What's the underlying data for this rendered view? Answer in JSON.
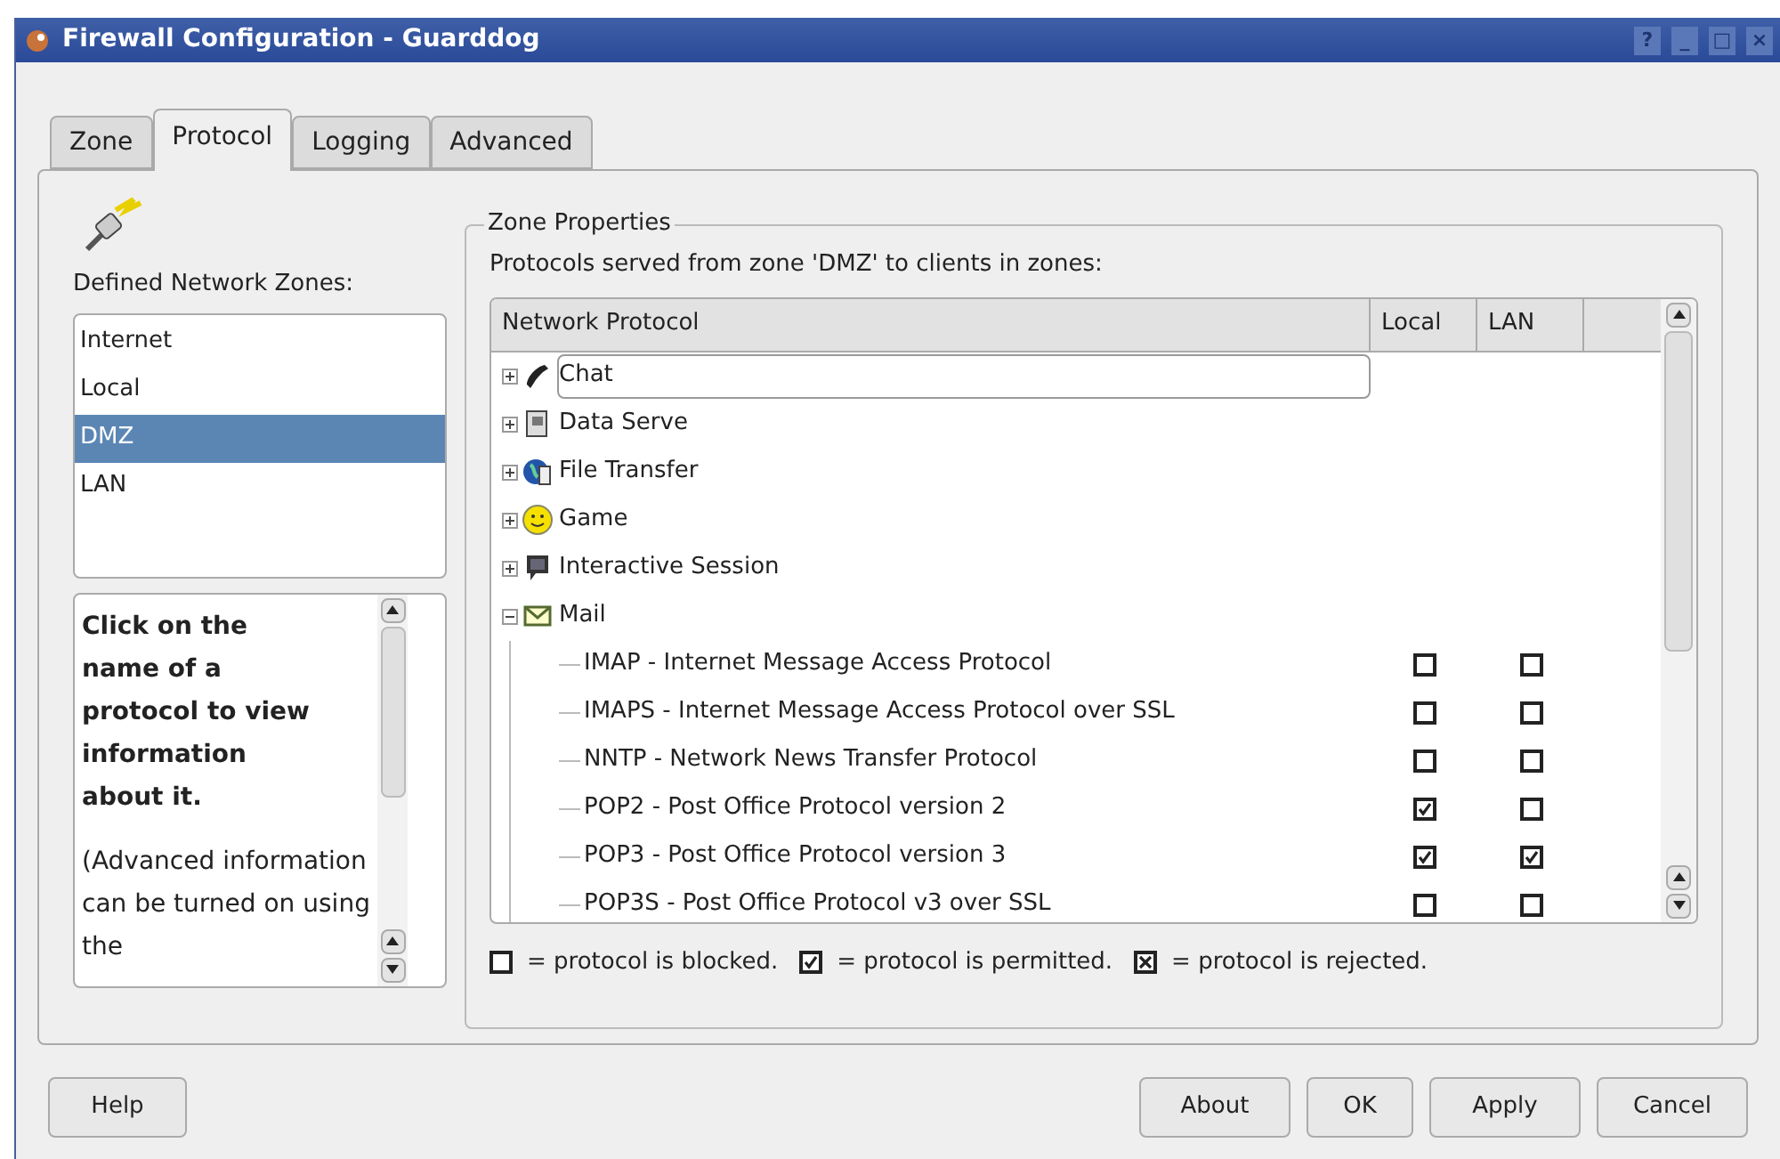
{
  "window": {
    "title": "Firewall Configuration - Guarddog",
    "title_buttons": [
      "?",
      "_",
      "□",
      "×"
    ]
  },
  "tabs": [
    {
      "label": "Zone",
      "selected": false
    },
    {
      "label": "Protocol",
      "selected": true
    },
    {
      "label": "Logging",
      "selected": false
    },
    {
      "label": "Advanced",
      "selected": false
    }
  ],
  "zones_label": "Defined Network Zones:",
  "zones": [
    {
      "label": "Internet",
      "selected": false
    },
    {
      "label": "Local",
      "selected": false
    },
    {
      "label": "DMZ",
      "selected": true
    },
    {
      "label": "LAN",
      "selected": false
    }
  ],
  "info": {
    "heading": "Click on the name of a protocol to view information about it.",
    "text": "(Advanced information can be turned on using the"
  },
  "zone_properties": {
    "title": "Zone Properties",
    "description": "Protocols served from zone 'DMZ' to clients in zones:",
    "columns": [
      "Network Protocol",
      "Local",
      "LAN"
    ],
    "tree": [
      {
        "label": "Chat",
        "expanded": false,
        "focused": true
      },
      {
        "label": "Data Serve",
        "expanded": false,
        "focused": false
      },
      {
        "label": "File Transfer",
        "expanded": false,
        "focused": false
      },
      {
        "label": "Game",
        "expanded": false,
        "focused": false
      },
      {
        "label": "Interactive Session",
        "expanded": false,
        "focused": false
      },
      {
        "label": "Mail",
        "expanded": true,
        "focused": false,
        "children": [
          {
            "label": "IMAP - Internet Message Access Protocol",
            "local": false,
            "lan": false
          },
          {
            "label": "IMAPS - Internet Message Access Protocol over SSL",
            "local": false,
            "lan": false
          },
          {
            "label": "NNTP - Network News Transfer Protocol",
            "local": false,
            "lan": false
          },
          {
            "label": "POP2 - Post Office Protocol version 2",
            "local": true,
            "lan": false
          },
          {
            "label": "POP3 - Post Office Protocol version 3",
            "local": true,
            "lan": true
          },
          {
            "label": "POP3S - Post Office Protocol v3 over SSL",
            "local": false,
            "lan": false
          }
        ]
      }
    ]
  },
  "legend": [
    {
      "kind": "blocked",
      "text": "= protocol is blocked."
    },
    {
      "kind": "permitted",
      "text": "= protocol is permitted."
    },
    {
      "kind": "rejected",
      "text": "= protocol is rejected."
    }
  ],
  "buttons_left": [
    "Help"
  ],
  "buttons_right": [
    "About",
    "OK",
    "Apply",
    "Cancel"
  ]
}
